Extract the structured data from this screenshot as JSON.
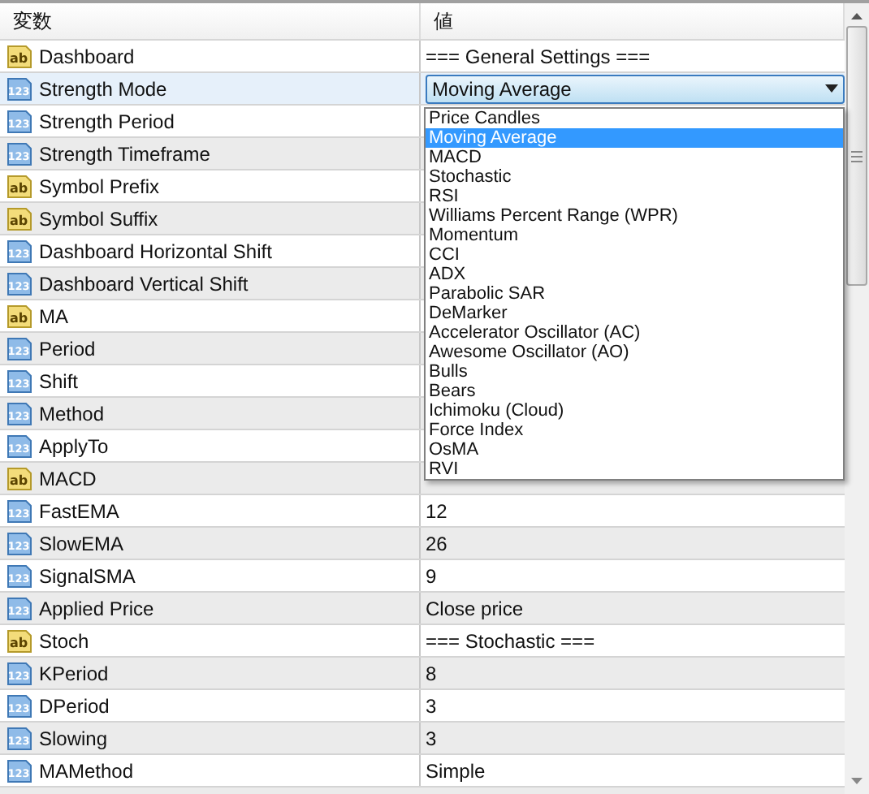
{
  "columns": [
    "変数",
    "値"
  ],
  "rows": [
    {
      "kind": "string",
      "icon_text": "ab",
      "name": "Dashboard",
      "value": "=== General Settings ===",
      "selected": false
    },
    {
      "kind": "number",
      "icon_text": "123",
      "name": "Strength Mode",
      "selected": true,
      "dropdown": {
        "value": "Moving Average",
        "options": [
          {
            "label": "Price Candles",
            "selected": false
          },
          {
            "label": "Moving Average",
            "selected": true
          },
          {
            "label": "MACD",
            "selected": false
          },
          {
            "label": "Stochastic",
            "selected": false
          },
          {
            "label": "RSI",
            "selected": false
          },
          {
            "label": "Williams Percent Range (WPR)",
            "selected": false
          },
          {
            "label": "Momentum",
            "selected": false
          },
          {
            "label": "CCI",
            "selected": false
          },
          {
            "label": "ADX",
            "selected": false
          },
          {
            "label": "Parabolic SAR",
            "selected": false
          },
          {
            "label": "DeMarker",
            "selected": false
          },
          {
            "label": "Accelerator Oscillator (AC)",
            "selected": false
          },
          {
            "label": "Awesome Oscillator (AO)",
            "selected": false
          },
          {
            "label": "Bulls",
            "selected": false
          },
          {
            "label": "Bears",
            "selected": false
          },
          {
            "label": "Ichimoku (Cloud)",
            "selected": false
          },
          {
            "label": "Force Index",
            "selected": false
          },
          {
            "label": "OsMA",
            "selected": false
          },
          {
            "label": "RVI",
            "selected": false
          }
        ]
      }
    },
    {
      "kind": "number",
      "icon_text": "123",
      "name": "Strength Period",
      "selected": false
    },
    {
      "kind": "number",
      "icon_text": "123",
      "name": "Strength Timeframe",
      "selected": false
    },
    {
      "kind": "string",
      "icon_text": "ab",
      "name": "Symbol Prefix",
      "selected": false
    },
    {
      "kind": "string",
      "icon_text": "ab",
      "name": "Symbol Suffix",
      "selected": false
    },
    {
      "kind": "number",
      "icon_text": "123",
      "name": "Dashboard Horizontal Shift",
      "selected": false
    },
    {
      "kind": "number",
      "icon_text": "123",
      "name": "Dashboard Vertical Shift",
      "selected": false
    },
    {
      "kind": "string",
      "icon_text": "ab",
      "name": "MA",
      "selected": false
    },
    {
      "kind": "number",
      "icon_text": "123",
      "name": "Period",
      "selected": false
    },
    {
      "kind": "number",
      "icon_text": "123",
      "name": "Shift",
      "selected": false
    },
    {
      "kind": "number",
      "icon_text": "123",
      "name": "Method",
      "selected": false
    },
    {
      "kind": "number",
      "icon_text": "123",
      "name": "ApplyTo",
      "selected": false
    },
    {
      "kind": "string",
      "icon_text": "ab",
      "name": "MACD",
      "selected": false
    },
    {
      "kind": "number",
      "icon_text": "123",
      "name": "FastEMA",
      "value": "12",
      "selected": false
    },
    {
      "kind": "number",
      "icon_text": "123",
      "name": "SlowEMA",
      "value": "26",
      "selected": false
    },
    {
      "kind": "number",
      "icon_text": "123",
      "name": "SignalSMA",
      "value": "9",
      "selected": false
    },
    {
      "kind": "number",
      "icon_text": "123",
      "name": "Applied Price",
      "value": "Close price",
      "selected": false
    },
    {
      "kind": "string",
      "icon_text": "ab",
      "name": "Stoch",
      "value": "=== Stochastic ===",
      "selected": false
    },
    {
      "kind": "number",
      "icon_text": "123",
      "name": "KPeriod",
      "value": "8",
      "selected": false
    },
    {
      "kind": "number",
      "icon_text": "123",
      "name": "DPeriod",
      "value": "3",
      "selected": false
    },
    {
      "kind": "number",
      "icon_text": "123",
      "name": "Slowing",
      "value": "3",
      "selected": false
    },
    {
      "kind": "number",
      "icon_text": "123",
      "name": "MAMethod",
      "value": "Simple",
      "selected": false
    }
  ]
}
